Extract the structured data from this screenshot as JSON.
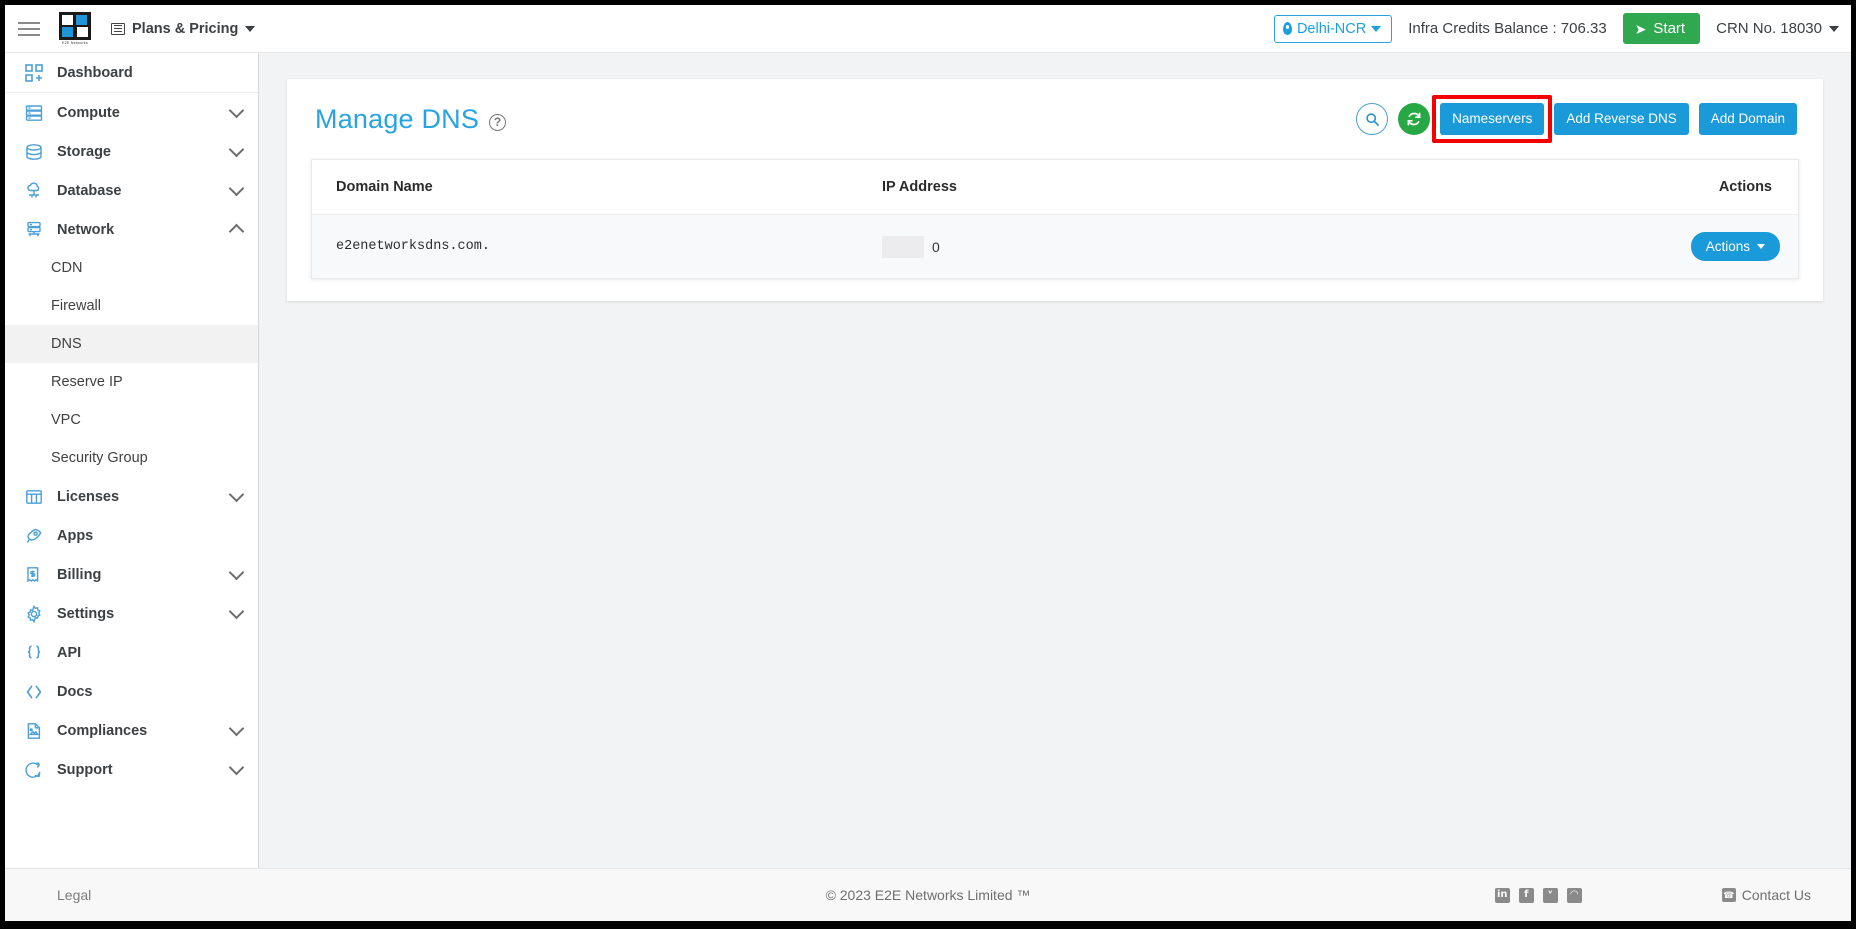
{
  "topbar": {
    "menu_icon": "hamburger-icon",
    "logo_label": "E2E Networks",
    "plans_label": "Plans & Pricing",
    "region": "Delhi-NCR",
    "credits": "Infra Credits Balance : 706.33",
    "start_label": "Start",
    "crn": "CRN No. 18030"
  },
  "sidebar": {
    "items": [
      {
        "label": "Dashboard",
        "icon": "dashboard-icon",
        "expandable": false
      },
      {
        "label": "Compute",
        "icon": "server-icon",
        "expandable": true,
        "expanded": false
      },
      {
        "label": "Storage",
        "icon": "database-stack-icon",
        "expandable": true,
        "expanded": false
      },
      {
        "label": "Database",
        "icon": "cloud-database-icon",
        "expandable": true,
        "expanded": false
      },
      {
        "label": "Network",
        "icon": "network-icon",
        "expandable": true,
        "expanded": true
      },
      {
        "label": "Licenses",
        "icon": "grid-icon",
        "expandable": true,
        "expanded": false
      },
      {
        "label": "Apps",
        "icon": "rocket-icon",
        "expandable": false
      },
      {
        "label": "Billing",
        "icon": "invoice-icon",
        "expandable": true,
        "expanded": false
      },
      {
        "label": "Settings",
        "icon": "gear-icon",
        "expandable": true,
        "expanded": false
      },
      {
        "label": "API",
        "icon": "braces-icon",
        "expandable": false
      },
      {
        "label": "Docs",
        "icon": "code-brackets-icon",
        "expandable": false
      },
      {
        "label": "Compliances",
        "icon": "document-icon",
        "expandable": true,
        "expanded": false
      },
      {
        "label": "Support",
        "icon": "support-chat-icon",
        "expandable": true,
        "expanded": false
      }
    ],
    "network_children": [
      {
        "label": "CDN",
        "active": false
      },
      {
        "label": "Firewall",
        "active": false
      },
      {
        "label": "DNS",
        "active": true
      },
      {
        "label": "Reserve IP",
        "active": false
      },
      {
        "label": "VPC",
        "active": false
      },
      {
        "label": "Security Group",
        "active": false
      }
    ]
  },
  "page": {
    "title": "Manage DNS",
    "help_icon": "question-mark-icon",
    "search_icon": "search-icon",
    "refresh_icon": "refresh-icon",
    "buttons": {
      "nameservers": "Nameservers",
      "add_reverse_dns": "Add Reverse DNS",
      "add_domain": "Add Domain"
    },
    "highlighted_button": "Nameservers"
  },
  "table": {
    "headers": [
      "Domain Name",
      "IP Address",
      "Actions"
    ],
    "rows": [
      {
        "domain": "e2enetworksdns.com.",
        "ip_redacted": true,
        "ip_suffix": "0",
        "action_label": "Actions"
      }
    ]
  },
  "footer": {
    "legal": "Legal",
    "copyright": "© 2023 E2E Networks Limited ™",
    "social": [
      {
        "name": "linkedin-icon",
        "glyph": "in"
      },
      {
        "name": "facebook-icon",
        "glyph": "f"
      },
      {
        "name": "twitter-icon",
        "glyph": "ᵛ"
      },
      {
        "name": "rss-icon",
        "glyph": "◠"
      }
    ],
    "contact": "Contact Us"
  },
  "colors": {
    "accent_blue": "#1a9ad9",
    "link_blue": "#29a3e0",
    "green": "#2fa84f",
    "refresh_green": "#27a844",
    "highlight_red": "#f50000",
    "sidebar_icon": "#4a9fd8"
  }
}
